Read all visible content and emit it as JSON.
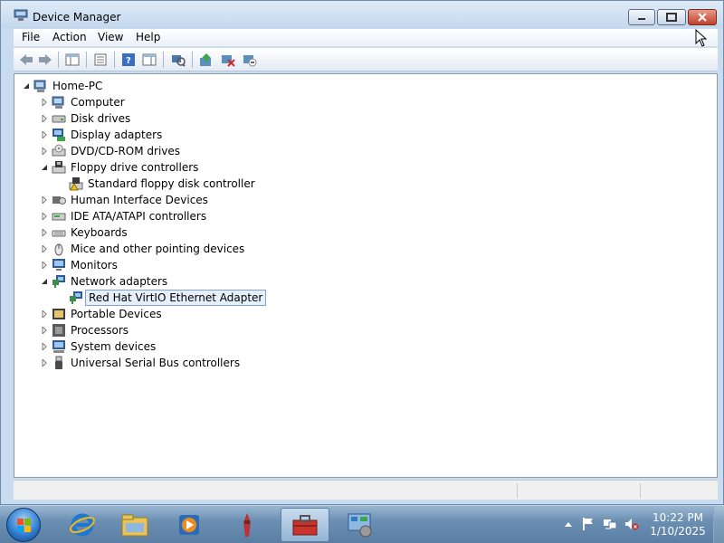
{
  "window": {
    "title": "Device Manager",
    "icon": "device-manager-icon"
  },
  "menu": {
    "items": [
      "File",
      "Action",
      "View",
      "Help"
    ]
  },
  "toolbar": {
    "buttons": [
      "back-arrow-icon",
      "forward-arrow-icon",
      "show-hide-console-tree-icon",
      "properties-icon",
      "help-icon",
      "action-pane-icon",
      "scan-hardware-icon",
      "update-driver-icon",
      "uninstall-icon",
      "disable-device-icon"
    ]
  },
  "tree": {
    "root": "Home-PC",
    "nodes": [
      {
        "label": "Computer",
        "icon": "computer-icon",
        "level": 1,
        "expanded": false
      },
      {
        "label": "Disk drives",
        "icon": "disk-drive-icon",
        "level": 1,
        "expanded": false
      },
      {
        "label": "Display adapters",
        "icon": "display-adapter-icon",
        "level": 1,
        "expanded": false
      },
      {
        "label": "DVD/CD-ROM drives",
        "icon": "dvd-drive-icon",
        "level": 1,
        "expanded": false
      },
      {
        "label": "Floppy drive controllers",
        "icon": "floppy-controller-icon",
        "level": 1,
        "expanded": true
      },
      {
        "label": "Standard floppy disk controller",
        "icon": "floppy-controller-warning-icon",
        "level": 2
      },
      {
        "label": "Human Interface Devices",
        "icon": "hid-icon",
        "level": 1,
        "expanded": false
      },
      {
        "label": "IDE ATA/ATAPI controllers",
        "icon": "ide-controller-icon",
        "level": 1,
        "expanded": false
      },
      {
        "label": "Keyboards",
        "icon": "keyboard-icon",
        "level": 1,
        "expanded": false
      },
      {
        "label": "Mice and other pointing devices",
        "icon": "mouse-icon",
        "level": 1,
        "expanded": false
      },
      {
        "label": "Monitors",
        "icon": "monitor-icon",
        "level": 1,
        "expanded": false
      },
      {
        "label": "Network adapters",
        "icon": "network-adapter-icon",
        "level": 1,
        "expanded": true
      },
      {
        "label": "Red Hat VirtIO Ethernet Adapter",
        "icon": "network-adapter-icon",
        "level": 2,
        "selected": true
      },
      {
        "label": "Portable Devices",
        "icon": "portable-device-icon",
        "level": 1,
        "expanded": false
      },
      {
        "label": "Processors",
        "icon": "processor-icon",
        "level": 1,
        "expanded": false
      },
      {
        "label": "System devices",
        "icon": "system-device-icon",
        "level": 1,
        "expanded": false
      },
      {
        "label": "Universal Serial Bus controllers",
        "icon": "usb-icon",
        "level": 1,
        "expanded": false
      }
    ]
  },
  "taskbar": {
    "items": [
      "start-orb",
      "internet-explorer-icon",
      "file-explorer-icon",
      "media-player-icon",
      "paint-icon",
      "toolbox-icon",
      "control-panel-icon"
    ],
    "tray": [
      "show-hidden-icons-arrow",
      "action-center-flag-icon",
      "network-icon",
      "volume-muted-icon"
    ],
    "clock": {
      "time": "10:22 PM",
      "date": "1/10/2025"
    }
  },
  "colors": {
    "accent": "#3a6ea5",
    "window_frame": "#c9dbee",
    "selection_border": "#7da2ce",
    "selection_fill": "#e5f0fb",
    "close_button": "#c2412a"
  }
}
